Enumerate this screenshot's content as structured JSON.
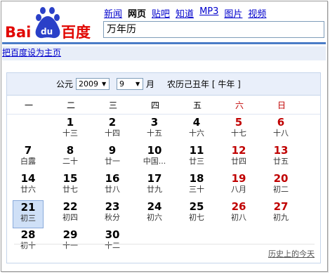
{
  "logo": {
    "text_bai": "Bai",
    "text_du": "du",
    "text_cn": "百度"
  },
  "nav": [
    {
      "label": "新闻",
      "current": false
    },
    {
      "label": "网页",
      "current": true
    },
    {
      "label": "贴吧",
      "current": false
    },
    {
      "label": "知道",
      "current": false
    },
    {
      "label": "MP3",
      "current": false
    },
    {
      "label": "图片",
      "current": false
    },
    {
      "label": "视频",
      "current": false
    }
  ],
  "search": {
    "value": "万年历"
  },
  "set_home": "把百度设为主页",
  "calendar": {
    "gongyuan_label": "公元",
    "year": "2009",
    "month": "9",
    "month_label": "月",
    "lunar_info": "农历己丑年 [ 牛年 ]",
    "weekdays": [
      "一",
      "二",
      "三",
      "四",
      "五",
      "六",
      "日"
    ],
    "days": [
      {
        "n": "1",
        "l": "十三"
      },
      {
        "n": "2",
        "l": "十四"
      },
      {
        "n": "3",
        "l": "十五"
      },
      {
        "n": "4",
        "l": "十六"
      },
      {
        "n": "5",
        "l": "十七"
      },
      {
        "n": "6",
        "l": "十八"
      },
      {
        "n": "7",
        "l": "白露"
      },
      {
        "n": "8",
        "l": "二十"
      },
      {
        "n": "9",
        "l": "廿一"
      },
      {
        "n": "10",
        "l": "中国..."
      },
      {
        "n": "11",
        "l": "廿三"
      },
      {
        "n": "12",
        "l": "廿四"
      },
      {
        "n": "13",
        "l": "廿五"
      },
      {
        "n": "14",
        "l": "廿六"
      },
      {
        "n": "15",
        "l": "廿七"
      },
      {
        "n": "16",
        "l": "廿八"
      },
      {
        "n": "17",
        "l": "廿九"
      },
      {
        "n": "18",
        "l": "三十"
      },
      {
        "n": "19",
        "l": "八月"
      },
      {
        "n": "20",
        "l": "初二"
      },
      {
        "n": "21",
        "l": "初三"
      },
      {
        "n": "22",
        "l": "初四"
      },
      {
        "n": "23",
        "l": "秋分"
      },
      {
        "n": "24",
        "l": "初六"
      },
      {
        "n": "25",
        "l": "初七"
      },
      {
        "n": "26",
        "l": "初八"
      },
      {
        "n": "27",
        "l": "初九"
      },
      {
        "n": "28",
        "l": "初十"
      },
      {
        "n": "29",
        "l": "十一"
      },
      {
        "n": "30",
        "l": "十二"
      }
    ],
    "today": "21",
    "history_link": "历史上的今天"
  },
  "colors": {
    "accent_blue": "#4a7cc7",
    "weekend_red": "#c00000",
    "link": "#0000cc"
  }
}
